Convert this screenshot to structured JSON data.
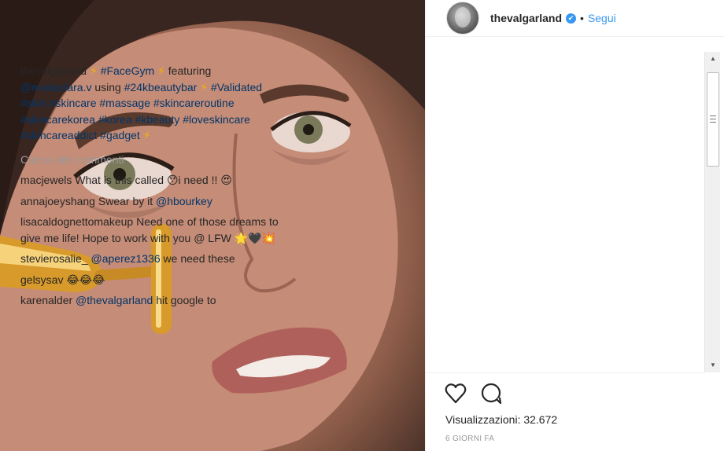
{
  "header": {
    "username": "thevalgarland",
    "verified_glyph": "✔",
    "separator": "•",
    "follow_label": "Segui",
    "avatar_icon": "profile-avatar"
  },
  "caption": {
    "username": "thevalgarland",
    "bolt": "⚡",
    "parts": [
      {
        "t": "tag",
        "v": "#FaceGym"
      },
      {
        "t": "bolt",
        "v": "⚡"
      },
      {
        "t": "text",
        "v": " featuring "
      },
      {
        "t": "tag",
        "v": "@mariaclara.v"
      },
      {
        "t": "text",
        "v": " using "
      },
      {
        "t": "tag",
        "v": "#24kbeautybar"
      },
      {
        "t": "bolt",
        "v": "⚡"
      },
      {
        "t": "tag",
        "v": "#Validated"
      },
      {
        "t": "tag",
        "v": "#skin"
      },
      {
        "t": "tag",
        "v": "#skincare"
      },
      {
        "t": "tag",
        "v": "#massage"
      },
      {
        "t": "tag",
        "v": "#skincareroutine"
      },
      {
        "t": "tag",
        "v": "#skincarekorea"
      },
      {
        "t": "tag",
        "v": "#korea"
      },
      {
        "t": "tag",
        "v": "#kbeauty"
      },
      {
        "t": "tag",
        "v": "#loveskincare"
      },
      {
        "t": "tag",
        "v": "#skincareaddict"
      },
      {
        "t": "tag",
        "v": "#gadget"
      },
      {
        "t": "bolt",
        "v": "⚡"
      }
    ]
  },
  "load_more": "Carica altri commenti",
  "comments": [
    {
      "user": "macjewels",
      "text": "What is this called 😯i need !! 😍"
    },
    {
      "user": "annajoeyshang",
      "text": "Swear by it ",
      "mention": "@hbourkey"
    },
    {
      "user": "lisacaldognettomakeup",
      "text": "Need one of those dreams to give me life! Hope to work with you @ LFW 🌟🖤💥"
    },
    {
      "user": "stevierosalie_",
      "text": " ",
      "mention": "@aperez1336",
      "after": " we need these"
    },
    {
      "user": "gelsysav",
      "text": "😂😂😂"
    },
    {
      "user": "karenalder",
      "text": " ",
      "mention": "@thevalgarland",
      "after": " hit google to"
    }
  ],
  "actions": {
    "like_icon": "heart-icon",
    "comment_icon": "comment-icon"
  },
  "views": "Visualizzazioni: 32.672",
  "time_ago": "6 GIORNI FA",
  "scrollbar": {
    "up": "▲",
    "down": "▼",
    "position": 0.12
  },
  "colors": {
    "link": "#003569",
    "follow": "#3897f0",
    "muted": "#999999",
    "gold": "#e0a82e"
  }
}
